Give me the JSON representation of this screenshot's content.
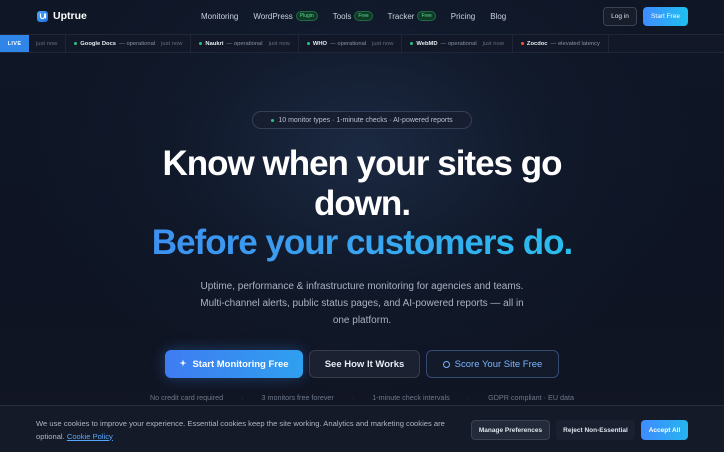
{
  "nav": {
    "brand": "Uptrue",
    "links": [
      {
        "label": "Monitoring",
        "badge": ""
      },
      {
        "label": "WordPress",
        "badge": "Plugin"
      },
      {
        "label": "Tools",
        "badge": "Free"
      },
      {
        "label": "Tracker",
        "badge": "Free"
      },
      {
        "label": "Pricing",
        "badge": ""
      },
      {
        "label": "Blog",
        "badge": ""
      }
    ],
    "login_label": "Log in",
    "start_label": "Start Free"
  },
  "ticker": {
    "live_label": "LIVE",
    "leading_time": "just now",
    "items": [
      {
        "name": "Google Docs",
        "status": "— operational",
        "time": "just now",
        "state": "ok"
      },
      {
        "name": "Naukri",
        "status": "— operational",
        "time": "just now",
        "state": "ok"
      },
      {
        "name": "WHO",
        "status": "— operational",
        "time": "just now",
        "state": "ok"
      },
      {
        "name": "WebMD",
        "status": "— operational",
        "time": "just now",
        "state": "ok"
      },
      {
        "name": "Zocdoc",
        "status": "— elevated latency",
        "time": "just now",
        "state": "warn"
      }
    ]
  },
  "hero": {
    "chip": "10 monitor types · 1-minute checks · AI-powered reports",
    "headline_1": "Know when your sites go",
    "headline_2": "down.",
    "headline_3": "Before your customers do.",
    "subtitle": "Uptime, performance & infrastructure monitoring for agencies and teams. Multi-channel alerts, public status pages, and AI-powered reports — all in one platform.",
    "cta_primary": "Start Monitoring Free",
    "cta_secondary": "See How It Works",
    "cta_tertiary": "Score Your Site Free",
    "facts": [
      "No credit card required",
      "3 monitors free forever",
      "1-minute check intervals",
      "GDPR compliant · EU data"
    ],
    "fact_separator": "·"
  },
  "cookie": {
    "text": "We use cookies to improve your experience. Essential cookies keep the site working. Analytics and marketing cookies are optional.",
    "link": "Cookie Policy",
    "manage_label": "Manage Preferences",
    "reject_label": "Reject Non-Essential",
    "accept_label": "Accept All"
  },
  "colors": {
    "accent": "#3f8cff",
    "accent_cyan": "#1ec0f0",
    "operational": "#27c285",
    "warning": "#ef5a3c",
    "background": "#0d1220"
  }
}
